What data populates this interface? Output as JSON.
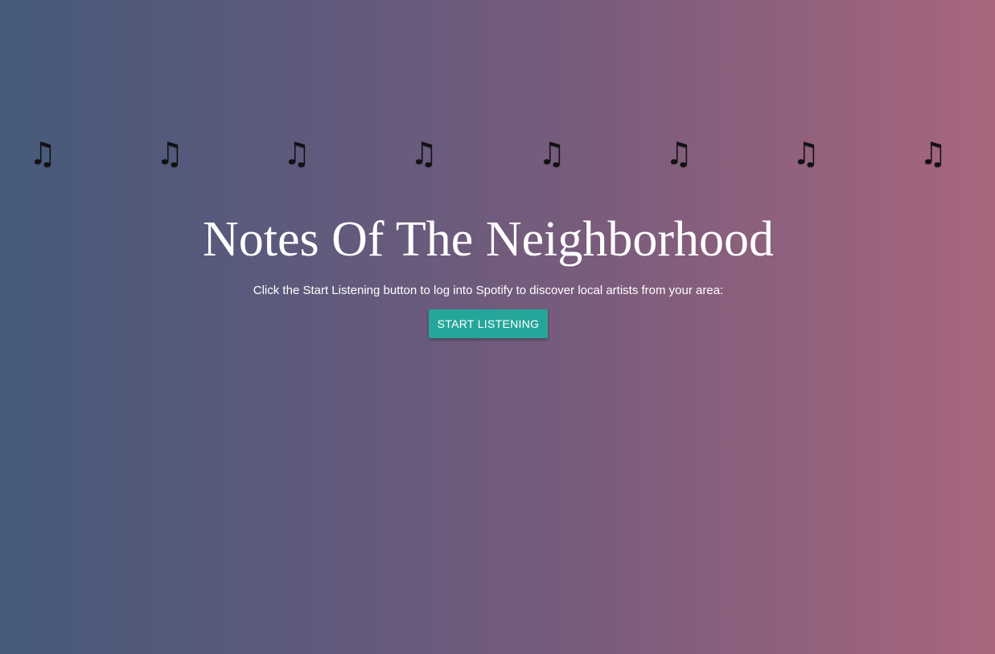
{
  "decoration": {
    "note_glyph": "♫",
    "note_count": 8
  },
  "hero": {
    "title": "Notes Of The Neighborhood",
    "subtitle": "Click the Start Listening button to log into Spotify to discover local artists from your area:",
    "button_label": "START LISTENING"
  },
  "colors": {
    "gradient_left": "#465a7a",
    "gradient_right": "#a8667e",
    "button_bg": "#26a69a",
    "text": "#ffffff"
  }
}
